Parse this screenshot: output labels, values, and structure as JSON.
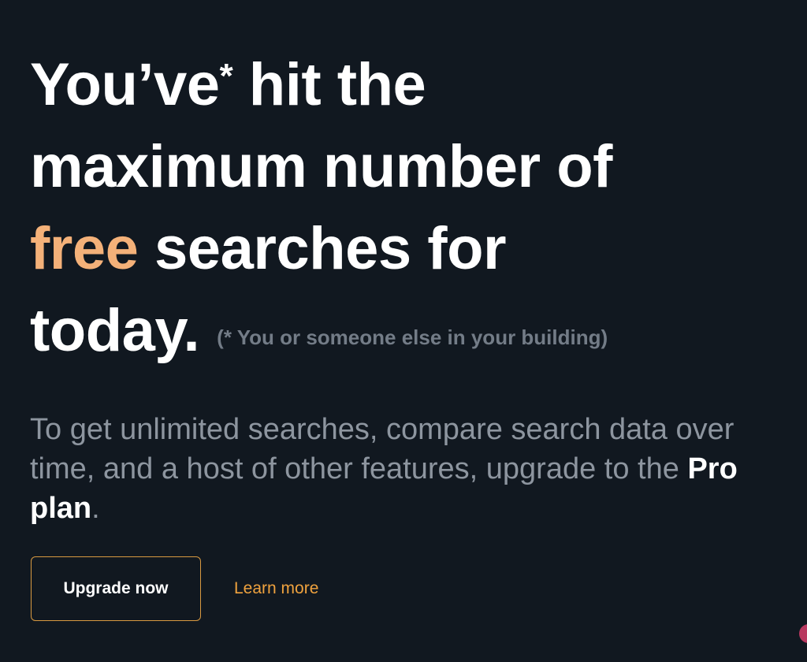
{
  "headline": {
    "line1_pre": "You’ve",
    "line1_asterisk": "*",
    "line1_post": " hit the",
    "line2": "maximum number of",
    "line3_accent": "free",
    "line3_rest": " searches for",
    "line4": "today.",
    "footnote": "(* You or someone else in your building)"
  },
  "body": {
    "text_before": "To get unlimited searches, compare search data over time, and a host of other features, upgrade to the ",
    "pro_plan": "Pro plan",
    "text_after": "."
  },
  "actions": {
    "upgrade_label": "Upgrade now",
    "learn_more_label": "Learn more"
  },
  "colors": {
    "background": "#111820",
    "accent": "#f4b179",
    "button_border": "#d99a41",
    "link": "#efa23e",
    "muted_text": "#8d959f",
    "corner_dot": "#b8385f"
  }
}
